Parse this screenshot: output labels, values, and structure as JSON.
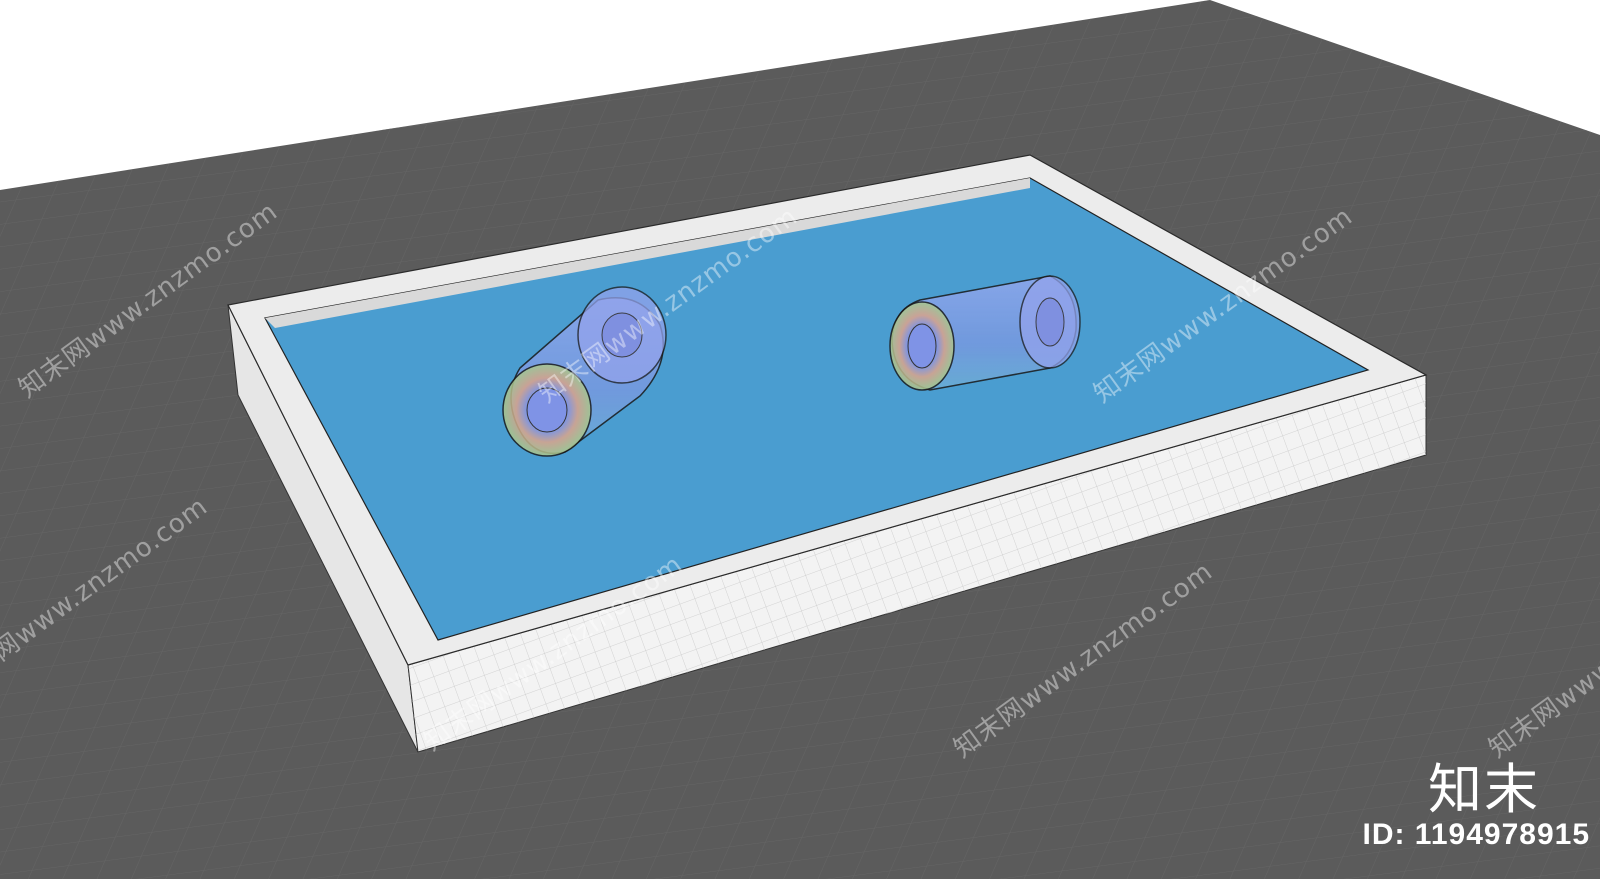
{
  "watermark": {
    "site": "知末网www.znzmo.com",
    "brand": "知末",
    "id_text": "ID: 1194978915"
  },
  "colors": {
    "ground": "#5a5a5a",
    "ground_grid": "#6e6e6e",
    "water": "#4a9dd0",
    "pool_edge": "#ecebeb",
    "pool_wall": "#f4f4f4",
    "float_tube": "#8ea4e6"
  },
  "scene": {
    "objects": [
      "ground-plane",
      "pool-coping",
      "pool-water",
      "float-tube",
      "float-tube"
    ]
  }
}
